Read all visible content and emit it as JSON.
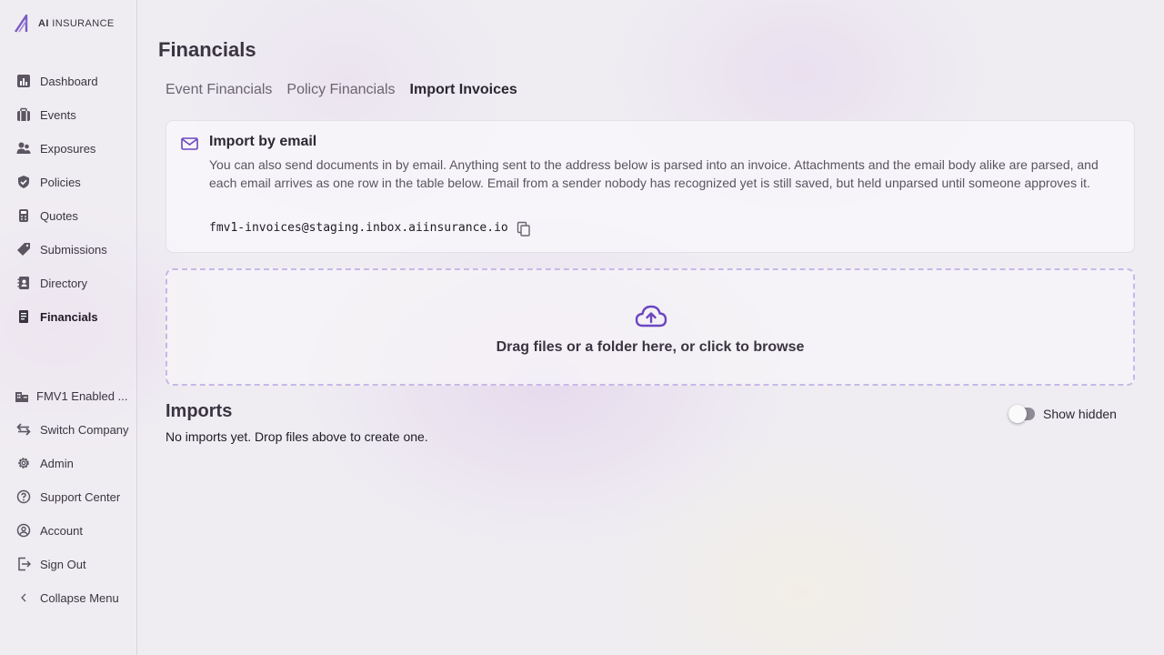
{
  "brand": {
    "prefix": "AI",
    "name": "INSURANCE",
    "accent": "#6b46c1"
  },
  "sidebar": {
    "items": [
      {
        "label": "Dashboard",
        "icon": "chart-icon"
      },
      {
        "label": "Events",
        "icon": "briefcase-icon"
      },
      {
        "label": "Exposures",
        "icon": "people-icon"
      },
      {
        "label": "Policies",
        "icon": "shield-icon"
      },
      {
        "label": "Quotes",
        "icon": "calculator-icon"
      },
      {
        "label": "Submissions",
        "icon": "tag-icon"
      },
      {
        "label": "Directory",
        "icon": "contact-book-icon"
      },
      {
        "label": "Financials",
        "icon": "receipt-icon",
        "active": true
      }
    ],
    "bottom_items": [
      {
        "label": "FMV1 Enabled ...",
        "icon": "building-icon"
      },
      {
        "label": "Switch Company",
        "icon": "swap-icon"
      },
      {
        "label": "Admin",
        "icon": "gear-icon"
      },
      {
        "label": "Support Center",
        "icon": "help-icon"
      },
      {
        "label": "Account",
        "icon": "account-icon"
      },
      {
        "label": "Sign Out",
        "icon": "sign-out-icon"
      },
      {
        "label": "Collapse Menu",
        "icon": "chevron-left-icon"
      }
    ]
  },
  "page": {
    "title": "Financials"
  },
  "tabs": [
    {
      "label": "Event Financials",
      "active": false
    },
    {
      "label": "Policy Financials",
      "active": false
    },
    {
      "label": "Import Invoices",
      "active": true
    }
  ],
  "email_import": {
    "title": "Import by email",
    "description": "You can also send documents in by email. Anything sent to the address below is parsed into an invoice. Attachments and the email body alike are parsed, and each email arrives as one row in the table below. Email from a sender nobody has recognized yet is still saved, but held unparsed until someone approves it.",
    "address": "fmv1-invoices@staging.inbox.aiinsurance.io"
  },
  "dropzone": {
    "text": "Drag files or a folder here, or click to browse"
  },
  "imports": {
    "title": "Imports",
    "empty_text": "No imports yet. Drop files above to create one.",
    "show_hidden_label": "Show hidden",
    "show_hidden": false
  }
}
